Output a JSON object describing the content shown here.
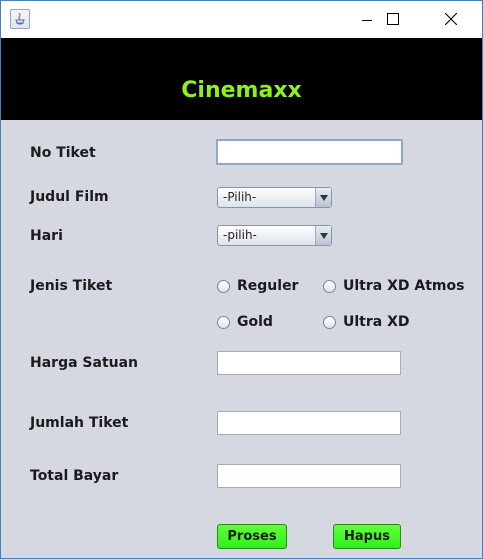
{
  "window": {
    "app_icon": "java-icon",
    "controls": {
      "minimize": "minimize-icon",
      "maximize": "maximize-icon",
      "close": "close-icon"
    }
  },
  "header": {
    "title": "Cinemaxx",
    "title_color": "#8cf21a",
    "background": "#000000"
  },
  "form": {
    "no_tiket": {
      "label": "No Tiket",
      "value": ""
    },
    "judul_film": {
      "label": "Judul Film",
      "selected": "-Pilih-"
    },
    "hari": {
      "label": "Hari",
      "selected": "-pilih-"
    },
    "jenis_tiket": {
      "label": "Jenis Tiket",
      "options": [
        "Reguler",
        "Ultra XD Atmos",
        "Gold",
        "Ultra XD"
      ],
      "selected": null
    },
    "harga_satuan": {
      "label": "Harga Satuan",
      "value": ""
    },
    "jumlah_tiket": {
      "label": "Jumlah Tiket",
      "value": ""
    },
    "total_bayar": {
      "label": "Total Bayar",
      "value": ""
    }
  },
  "buttons": {
    "proses": "Proses",
    "hapus": "Hapus",
    "color": "#3cf524"
  },
  "panel_background": "#d5d8e0"
}
